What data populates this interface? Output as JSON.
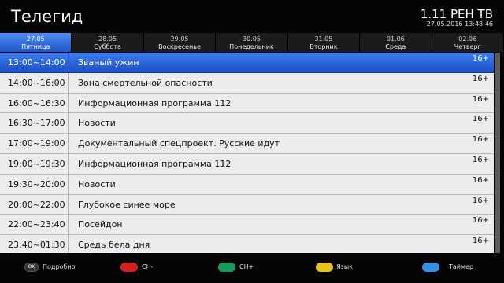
{
  "header": {
    "title": "Телегид",
    "channel": "1.11 РЕН ТВ",
    "datetime": "27.05.2016 13:48:46"
  },
  "tabs": [
    {
      "date": "27.05",
      "day": "Пятница"
    },
    {
      "date": "28.05",
      "day": "Суббота"
    },
    {
      "date": "29.05",
      "day": "Воскресенье"
    },
    {
      "date": "30.05",
      "day": "Понедельник"
    },
    {
      "date": "31.05",
      "day": "Вторник"
    },
    {
      "date": "01.06",
      "day": "Среда"
    },
    {
      "date": "02.06",
      "day": "Четверг"
    }
  ],
  "programs": [
    {
      "time": "13:00~14:00",
      "title": "Званый ужин",
      "age": "16+"
    },
    {
      "time": "14:00~16:00",
      "title": "Зона смертельной опасности",
      "age": "16+"
    },
    {
      "time": "16:00~16:30",
      "title": "Информационная программа 112",
      "age": "16+"
    },
    {
      "time": "16:30~17:00",
      "title": "Новости",
      "age": "16+"
    },
    {
      "time": "17:00~19:00",
      "title": "Документальный спецпроект. Русские идут",
      "age": "16+"
    },
    {
      "time": "19:00~19:30",
      "title": "Информационная программа 112",
      "age": "16+"
    },
    {
      "time": "19:30~20:00",
      "title": "Новости",
      "age": "16+"
    },
    {
      "time": "20:00~22:00",
      "title": "Глубокое синее море",
      "age": "16+"
    },
    {
      "time": "22:00~23:40",
      "title": "Посейдон",
      "age": "16+"
    },
    {
      "time": "23:40~01:30",
      "title": "Средь бела дня",
      "age": "16+"
    }
  ],
  "footer": {
    "ok_key": "OK",
    "ok_label": "Подробно",
    "red_label": "CH-",
    "green_label": "CH+",
    "yellow_label": "Язык",
    "blue_label": "Таймер"
  },
  "colors": {
    "accent": "#2f6be0",
    "red": "#d42020",
    "green": "#1a9a5a",
    "yellow": "#e6c21a",
    "blue": "#3a8ee6"
  }
}
